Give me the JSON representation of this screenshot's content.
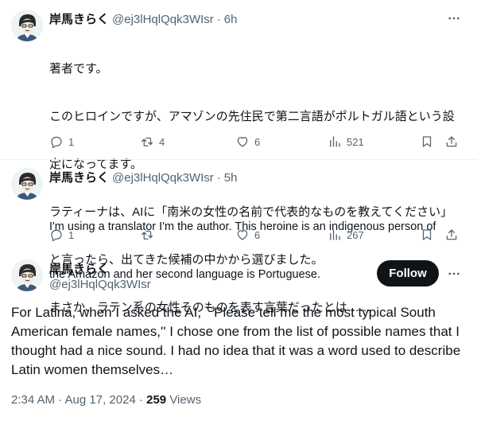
{
  "colors": {
    "text": "#0f1419",
    "muted": "#536471",
    "follow_bg": "#0f1419",
    "border": "#eff3f4"
  },
  "replies": [
    {
      "name": "岸馬きらく",
      "handle": "@ej3lHqlQqk3WIsr",
      "time": "6h",
      "text_lines": [
        "著者です。",
        "このヒロインですが、アマゾンの先住民で第二言語がポルトガル語という設",
        "定になってます。",
        "ラティーナは、AIに「南米の女性の名前で代表的なものを教えてください」",
        "と言ったら、出てきた候補の中かから選びました。",
        "まさか、ラテン系の女性そのものを表す言葉だったとは……"
      ],
      "replies_count": "1",
      "reposts_count": "4",
      "likes_count": "6",
      "views_count": "521"
    },
    {
      "name": "岸馬きらく",
      "handle": "@ej3lHqlQqk3WIsr",
      "time": "5h",
      "text_lines": [
        "I'm using a translator I'm the author. This heroine is an indigenous person of",
        "the Amazon and her second language is Portuguese."
      ],
      "replies_count": "1",
      "reposts_count": "",
      "likes_count": "6",
      "views_count": "267"
    }
  ],
  "main": {
    "name": "岸馬きらく",
    "handle": "@ej3lHqlQqk3WIsr",
    "follow_label": "Follow",
    "text": "For Latina, when I asked the AI, ``Please tell me the most typical South American female names,'' I chose one from the list of possible names that I thought had a nice sound. I had no idea that it was a word used to describe Latin women themselves…",
    "timestamp": "2:34 AM · Aug 17, 2024 · ",
    "views": "259",
    "views_label": " Views"
  },
  "icons": {
    "avatar": "avatar-illustration-icon",
    "more": "more-dots-icon",
    "reply": "reply-bubble-icon",
    "repost": "repost-icon",
    "like": "heart-icon",
    "views": "bar-chart-icon",
    "bookmark": "bookmark-icon",
    "share": "share-icon"
  }
}
